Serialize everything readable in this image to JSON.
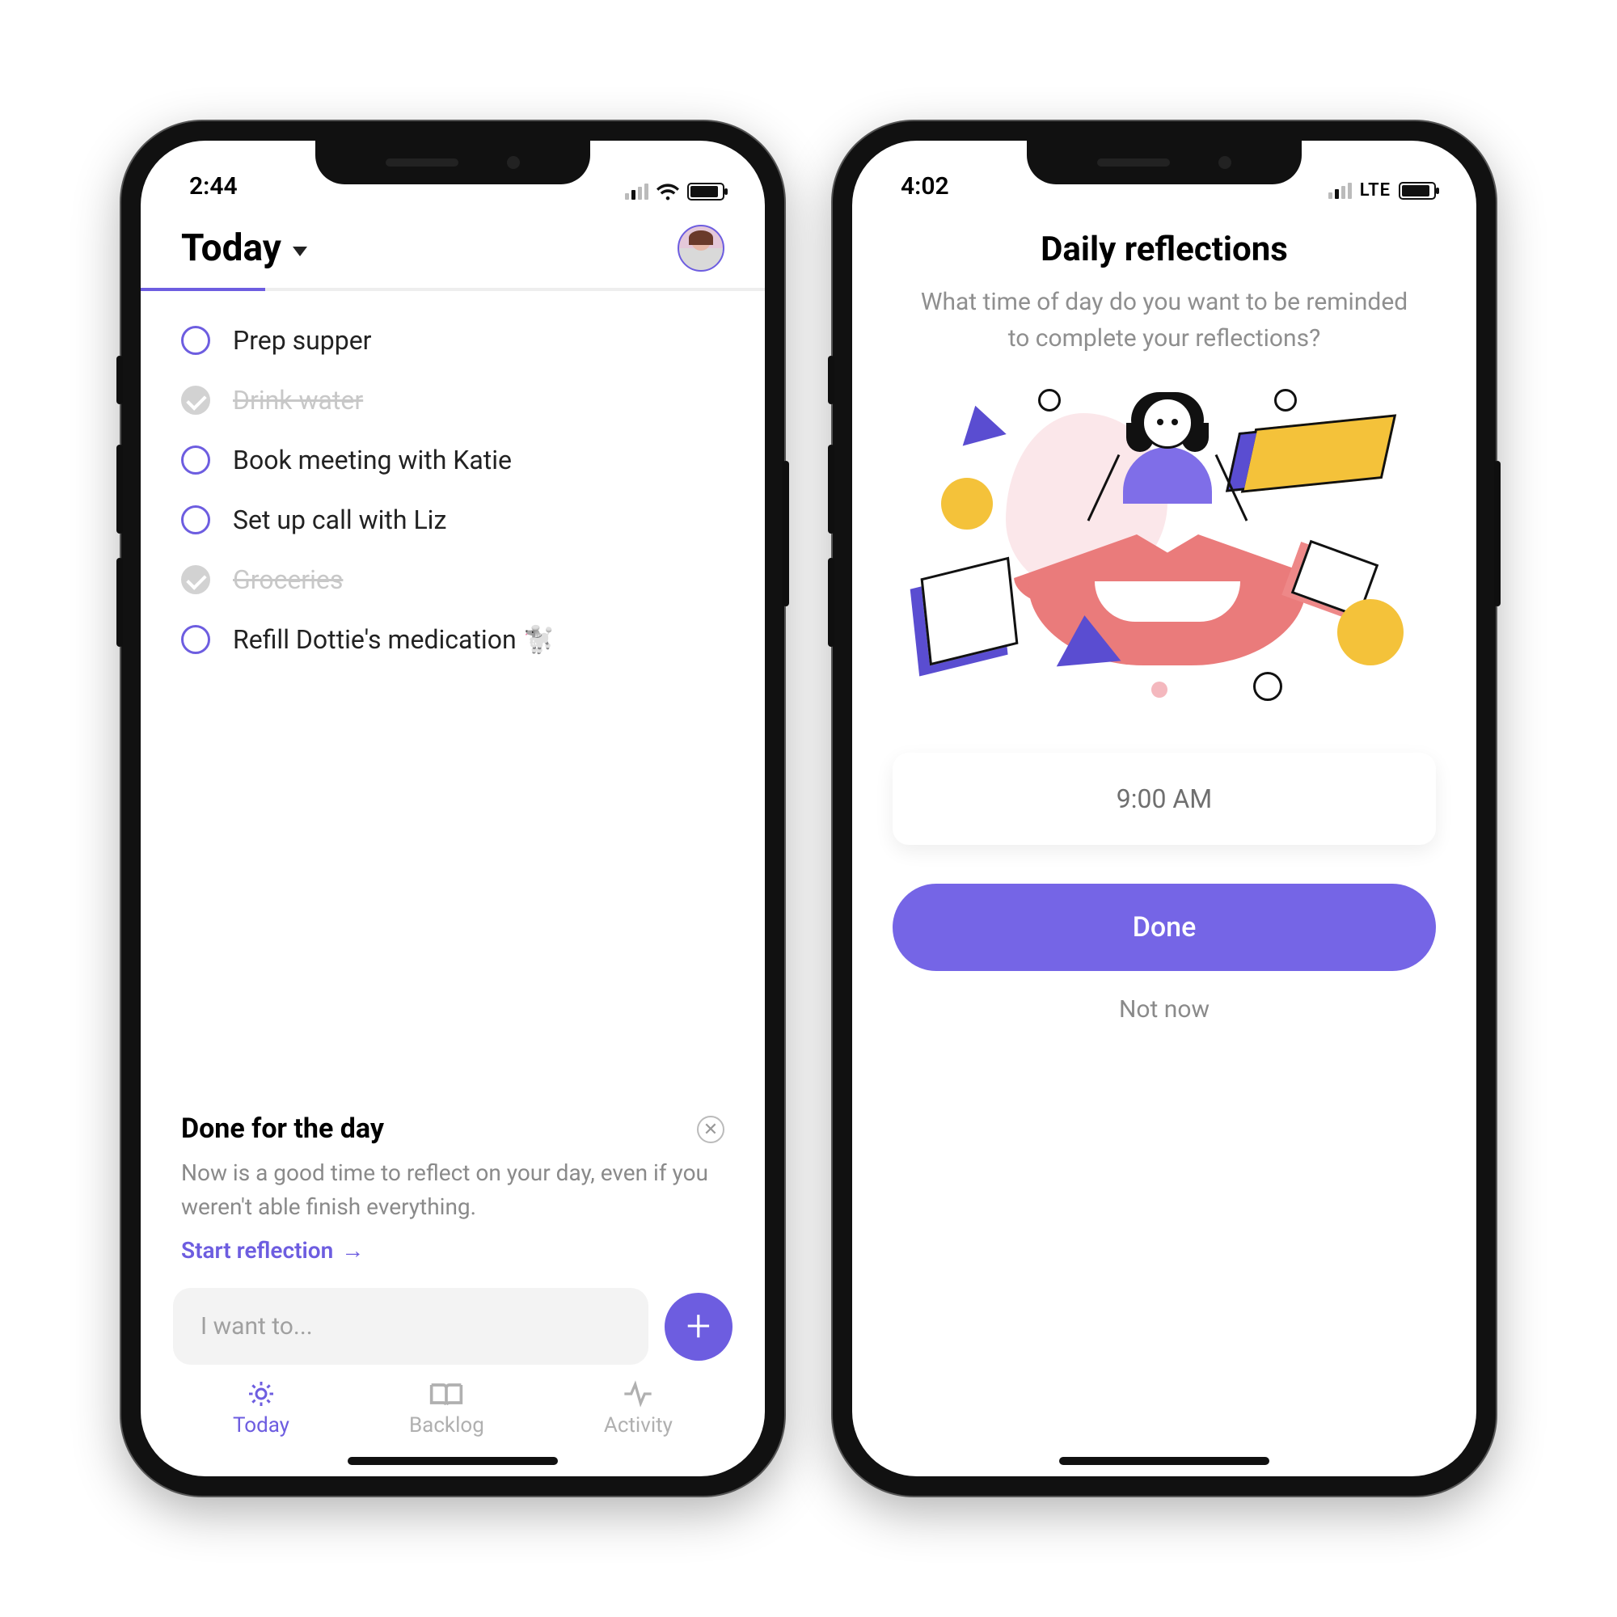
{
  "left": {
    "status": {
      "time": "2:44"
    },
    "header": {
      "title": "Today"
    },
    "tasks": [
      {
        "text": "Prep supper",
        "done": false
      },
      {
        "text": "Drink water",
        "done": true
      },
      {
        "text": "Book meeting with Katie",
        "done": false
      },
      {
        "text": "Set up call with Liz",
        "done": false
      },
      {
        "text": "Groceries",
        "done": true
      },
      {
        "text": "Refill Dottie's medication 🐩",
        "done": false
      }
    ],
    "done_card": {
      "title": "Done for the day",
      "body": "Now is a good time to reflect on your day, even if you weren't able finish everything.",
      "cta": "Start reflection"
    },
    "input": {
      "placeholder": "I want to..."
    },
    "tabs": [
      {
        "label": "Today",
        "active": true
      },
      {
        "label": "Backlog",
        "active": false
      },
      {
        "label": "Activity",
        "active": false
      }
    ]
  },
  "right": {
    "status": {
      "time": "4:02",
      "network": "LTE"
    },
    "title": "Daily reflections",
    "subtitle": "What time of day do you want to be reminded to complete your reflections?",
    "time_selected": "9:00 AM",
    "done_label": "Done",
    "notnow_label": "Not now"
  }
}
